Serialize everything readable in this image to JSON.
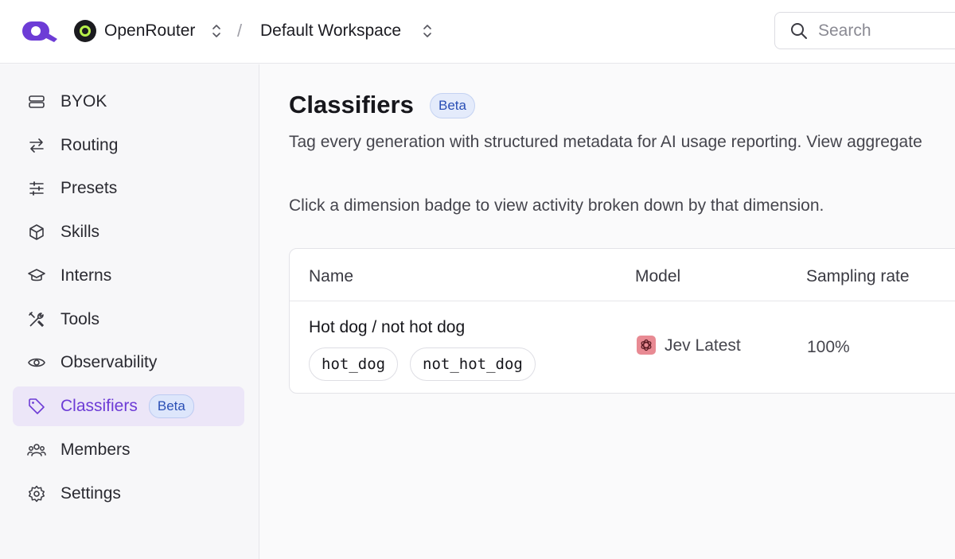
{
  "header": {
    "org_name": "OpenRouter",
    "breadcrumb_separator": "/",
    "workspace_name": "Default Workspace",
    "search_placeholder": "Search",
    "logo_icon": "openrouter-logo",
    "brand_color": "#6d3cd6"
  },
  "sidebar": {
    "items": [
      {
        "label": "BYOK",
        "icon": "server-icon"
      },
      {
        "label": "Routing",
        "icon": "arrows-swap-icon"
      },
      {
        "label": "Presets",
        "icon": "sliders-icon"
      },
      {
        "label": "Skills",
        "icon": "cube-icon"
      },
      {
        "label": "Interns",
        "icon": "graduation-cap-icon"
      },
      {
        "label": "Tools",
        "icon": "tools-icon"
      },
      {
        "label": "Observability",
        "icon": "eye-icon"
      },
      {
        "label": "Classifiers",
        "icon": "tag-icon",
        "active": true,
        "badge": "Beta"
      },
      {
        "label": "Members",
        "icon": "users-icon"
      },
      {
        "label": "Settings",
        "icon": "gear-icon"
      }
    ]
  },
  "main": {
    "title": "Classifiers",
    "title_badge": "Beta",
    "subtitle": "Tag every generation with structured metadata for AI usage reporting. View aggregate",
    "hint": "Click a dimension badge to view activity broken down by that dimension.",
    "table": {
      "columns": [
        "Name",
        "Model",
        "Sampling rate"
      ],
      "rows": [
        {
          "name": "Hot dog / not hot dog",
          "dimensions": [
            "hot_dog",
            "not_hot_dog"
          ],
          "model": "Jev Latest",
          "model_icon": "openai-logo-icon",
          "sampling_rate": "100%"
        }
      ]
    }
  }
}
